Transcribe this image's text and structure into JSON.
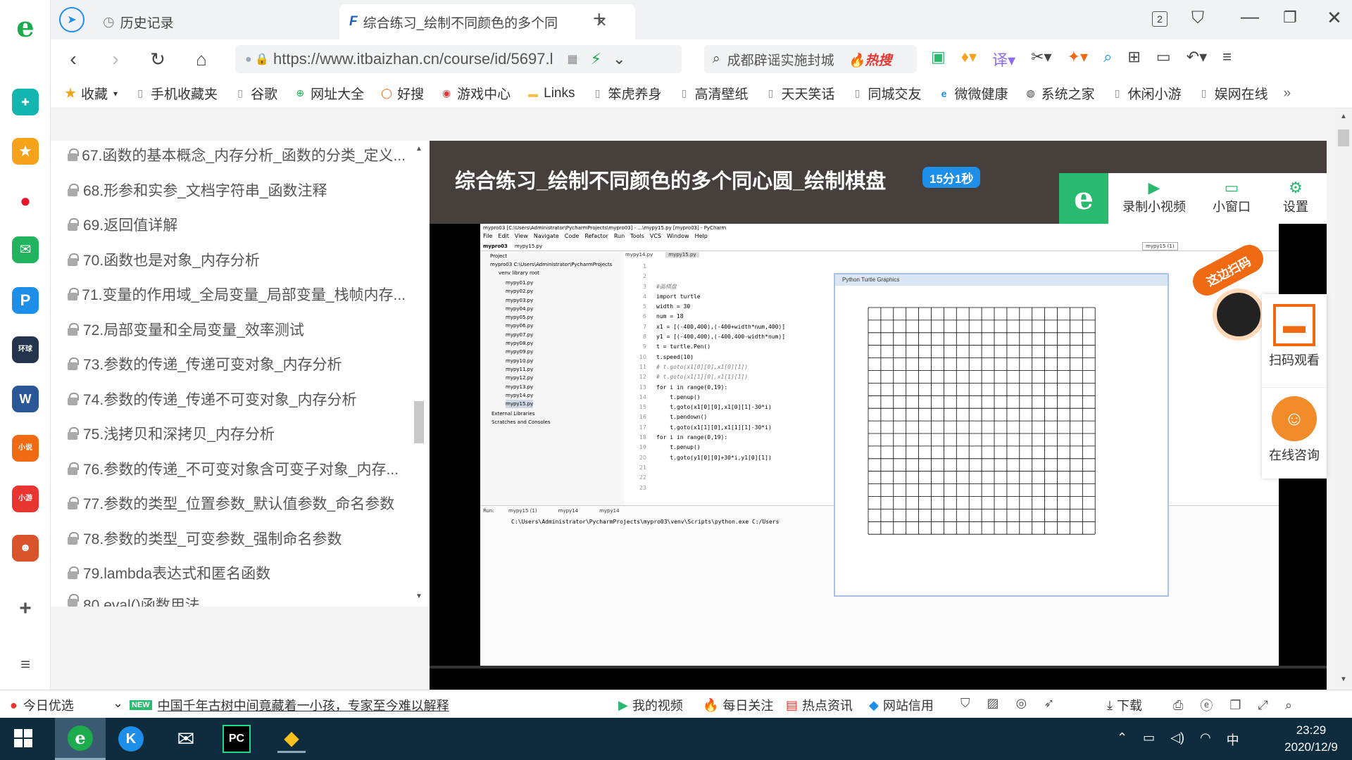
{
  "tabs": [
    {
      "label": "历史记录",
      "active": false
    },
    {
      "label": "综合练习_绘制不同颜色的多个同",
      "active": true
    }
  ],
  "tab_count": "2",
  "address": {
    "url": "https://www.itbaizhan.cn/course/id/5697.l"
  },
  "search": {
    "text": "成都辟谣实施封城",
    "hot_label": "热搜"
  },
  "bookmarks": [
    "收藏",
    "手机收藏夹",
    "谷歌",
    "网址大全",
    "好搜",
    "游戏中心",
    "Links",
    "笨虎养身",
    "高清壁纸",
    "天天笑话",
    "同城交友",
    "微微健康",
    "系统之家",
    "休闲小游",
    "娱网在线"
  ],
  "lessons": [
    "67.函数的基本概念_内存分析_函数的分类_定义...",
    "68.形参和实参_文档字符串_函数注释",
    "69.返回值详解",
    "70.函数也是对象_内存分析",
    "71.变量的作用域_全局变量_局部变量_栈帧内存...",
    "72.局部变量和全局变量_效率测试",
    "73.参数的传递_传递可变对象_内存分析",
    "74.参数的传递_传递不可变对象_内存分析",
    "75.浅拷贝和深拷贝_内存分析",
    "76.参数的传递_不可变对象含可变子对象_内存...",
    "77.参数的类型_位置参数_默认值参数_命名参数",
    "78.参数的类型_可变参数_强制命名参数",
    "79.lambda表达式和匿名函数",
    "80.eval()函数用法"
  ],
  "video": {
    "title": "综合练习_绘制不同颜色的多个同心圆_绘制棋盘",
    "duration": "15分1秒",
    "tools": [
      "录制小视频",
      "小窗口",
      "设置"
    ]
  },
  "ide": {
    "title": "mypro03 [C:\\Users\\Administrator\\PycharmProjects\\mypro03] - ...\\mypy15.py [mypro03] - PyCharm",
    "menus": [
      "File",
      "Edit",
      "View",
      "Navigate",
      "Code",
      "Refactor",
      "Run",
      "Tools",
      "VCS",
      "Window",
      "Help"
    ],
    "breadcrumb": [
      "mypro03",
      "mypy15.py"
    ],
    "run_config": "mypy15 (1)",
    "project_label": "Project",
    "project_root": "mypro03  C:\\Users\\Administrator\\PycharmProjects",
    "venv": "venv  library root",
    "files": [
      "mypy01.py",
      "mypy02.py",
      "mypy03.py",
      "mypy04.py",
      "mypy05.py",
      "mypy06.py",
      "mypy07.py",
      "mypy08.py",
      "mypy09.py",
      "mypy10.py",
      "mypy11.py",
      "mypy12.py",
      "mypy13.py",
      "mypy14.py",
      "mypy15.py"
    ],
    "ext_libs": "External Libraries",
    "scratches": "Scratches and Consoles",
    "editor_tabs": [
      "mypy14.py",
      "mypy15.py"
    ],
    "line_numbers": [
      "1",
      "2",
      "3",
      "4",
      "5",
      "6",
      "7",
      "8",
      "9",
      "10",
      "11",
      "12",
      "13",
      "14",
      "15",
      "16",
      "17",
      "18",
      "19",
      "20",
      "21",
      "22",
      "23"
    ],
    "code": [
      "#画棋盘",
      "import turtle",
      "",
      "",
      "width = 30",
      "num = 18",
      "",
      "x1 = [(-400,400),(-400+width*num,400)]",
      "y1 = [(-400,400),(-400,400-width*num)]",
      "t = turtle.Pen()",
      "t.speed(10)",
      "# t.goto(x1[0][0],x1[0][1])",
      "# t.goto(x1[1][0],x1[1][1])",
      "",
      "for i in range(0,19):",
      "    t.penup()",
      "    t.goto(x1[0][0],x1[0][1]-30*i)",
      "    t.pendown()",
      "    t.goto(x1[1][0],x1[1][1]-30*i)",
      "",
      "for i in range(0,19):",
      "    t.penup()",
      "    t.goto(y1[0][0]+30*i,y1[0][1])"
    ],
    "run_label": "Run:",
    "run_tabs": [
      "mypy15 (1)",
      "mypy14",
      "mypy14"
    ],
    "console": "C:\\Users\\Administrator\\PycharmProjects\\mypro03\\venv\\Scripts\\python.exe C:/Users"
  },
  "turtle_window": {
    "title": "Python Turtle Graphics"
  },
  "scan_banner": "这边扫码",
  "side_widget": {
    "scan": "扫码观看",
    "consult": "在线咨询"
  },
  "status": {
    "news_tag": "今日优选",
    "news_badge": "NEW",
    "news_text": "中国千年古树中间竟藏着一小孩，专家至今难以解释",
    "items": [
      "我的视频",
      "每日关注",
      "热点资讯",
      "网站信用",
      "下载"
    ]
  },
  "taskbar": {
    "time": "23:29",
    "date": "2020/12/9",
    "ime": "中"
  },
  "colors": {
    "accent_green": "#29b96f",
    "hot_red": "#e8352f",
    "badge_blue": "#1e8fe8",
    "video_header": "#473f3b"
  }
}
